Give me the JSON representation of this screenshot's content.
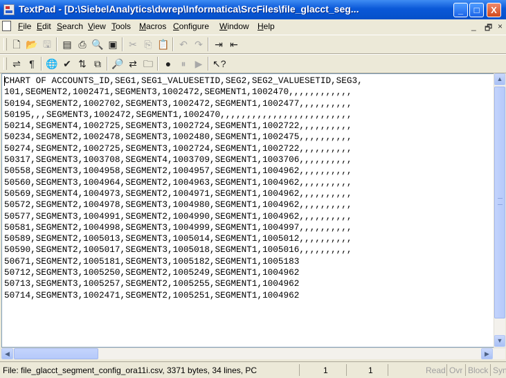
{
  "window": {
    "title": "TextPad - [D:\\SiebelAnalytics\\dwrep\\Informatica\\SrcFiles\\file_glacct_seg...",
    "controls": [
      "_",
      "□",
      "X"
    ],
    "mdi_controls": [
      "_",
      "🗗",
      "×"
    ]
  },
  "menu": {
    "items": [
      {
        "label": "File",
        "u": "F",
        "rest": "ile"
      },
      {
        "label": "Edit",
        "u": "E",
        "rest": "dit"
      },
      {
        "label": "Search",
        "u": "S",
        "rest": "earch"
      },
      {
        "label": "View",
        "u": "V",
        "rest": "iew"
      },
      {
        "label": "Tools",
        "u": "T",
        "rest": "ools"
      },
      {
        "label": "Macros",
        "u": "M",
        "rest": "acros"
      },
      {
        "label": "Configure",
        "u": "C",
        "rest": "onfigure"
      },
      {
        "label": "Window",
        "u": "W",
        "rest": "indow"
      },
      {
        "label": "Help",
        "u": "H",
        "rest": "elp"
      }
    ]
  },
  "editor": {
    "lines": [
      "CHART OF ACCOUNTS_ID,SEG1,SEG1_VALUESETID,SEG2,SEG2_VALUESETID,SEG3,",
      "101,SEGMENT2,1002471,SEGMENT3,1002472,SEGMENT1,1002470,,,,,,,,,,,,",
      "50194,SEGMENT2,1002702,SEGMENT3,1002472,SEGMENT1,1002477,,,,,,,,,,",
      "50195,,,SEGMENT3,1002472,SEGMENT1,1002470,,,,,,,,,,,,,,,,,,,,,,,,,",
      "50214,SEGMENT4,1002725,SEGMENT3,1002724,SEGMENT1,1002722,,,,,,,,,,",
      "50234,SEGMENT2,1002478,SEGMENT3,1002480,SEGMENT1,1002475,,,,,,,,,,",
      "50274,SEGMENT2,1002725,SEGMENT3,1002724,SEGMENT1,1002722,,,,,,,,,,",
      "50317,SEGMENT3,1003708,SEGMENT4,1003709,SEGMENT1,1003706,,,,,,,,,,",
      "50558,SEGMENT3,1004958,SEGMENT2,1004957,SEGMENT1,1004962,,,,,,,,,,",
      "50560,SEGMENT3,1004964,SEGMENT2,1004963,SEGMENT1,1004962,,,,,,,,,,",
      "50569,SEGMENT4,1004973,SEGMENT2,1004971,SEGMENT1,1004962,,,,,,,,,,",
      "50572,SEGMENT2,1004978,SEGMENT3,1004980,SEGMENT1,1004962,,,,,,,,,,",
      "50577,SEGMENT3,1004991,SEGMENT2,1004990,SEGMENT1,1004962,,,,,,,,,,",
      "50581,SEGMENT2,1004998,SEGMENT3,1004999,SEGMENT1,1004997,,,,,,,,,,",
      "50589,SEGMENT2,1005013,SEGMENT3,1005014,SEGMENT1,1005012,,,,,,,,,,",
      "50590,SEGMENT2,1005017,SEGMENT3,1005018,SEGMENT1,1005016,,,,,,,,,,",
      "50671,SEGMENT2,1005181,SEGMENT3,1005182,SEGMENT1,1005183",
      "50712,SEGMENT3,1005250,SEGMENT2,1005249,SEGMENT1,1004962",
      "50713,SEGMENT3,1005257,SEGMENT2,1005255,SEGMENT1,1004962",
      "50714,SEGMENT3,1002471,SEGMENT2,1005251,SEGMENT1,1004962"
    ]
  },
  "status": {
    "file_info": "File: file_glacct_segment_config_ora11i.csv, 3371 bytes, 34 lines, PC",
    "line": "1",
    "col": "1",
    "modes": [
      "Read",
      "Ovr",
      "Block",
      "Sync"
    ]
  }
}
